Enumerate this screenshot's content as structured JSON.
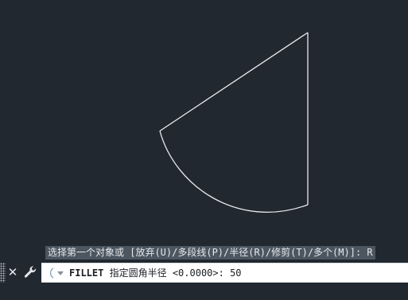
{
  "drawing": {
    "stroke_color": "#e8ecef",
    "background_color": "#212830"
  },
  "command_line": {
    "history_line": "选择第一个对象或 [放弃(U)/多段线(P)/半径(R)/修剪(T)/多个(M)]: R",
    "command_name": "FILLET",
    "prompt_text": "指定圆角半径 <0.0000>: ",
    "input_value": "50",
    "close_icon": "close-icon",
    "settings_icon": "wrench-icon",
    "dropdown_icon": "chevron-down-icon"
  }
}
